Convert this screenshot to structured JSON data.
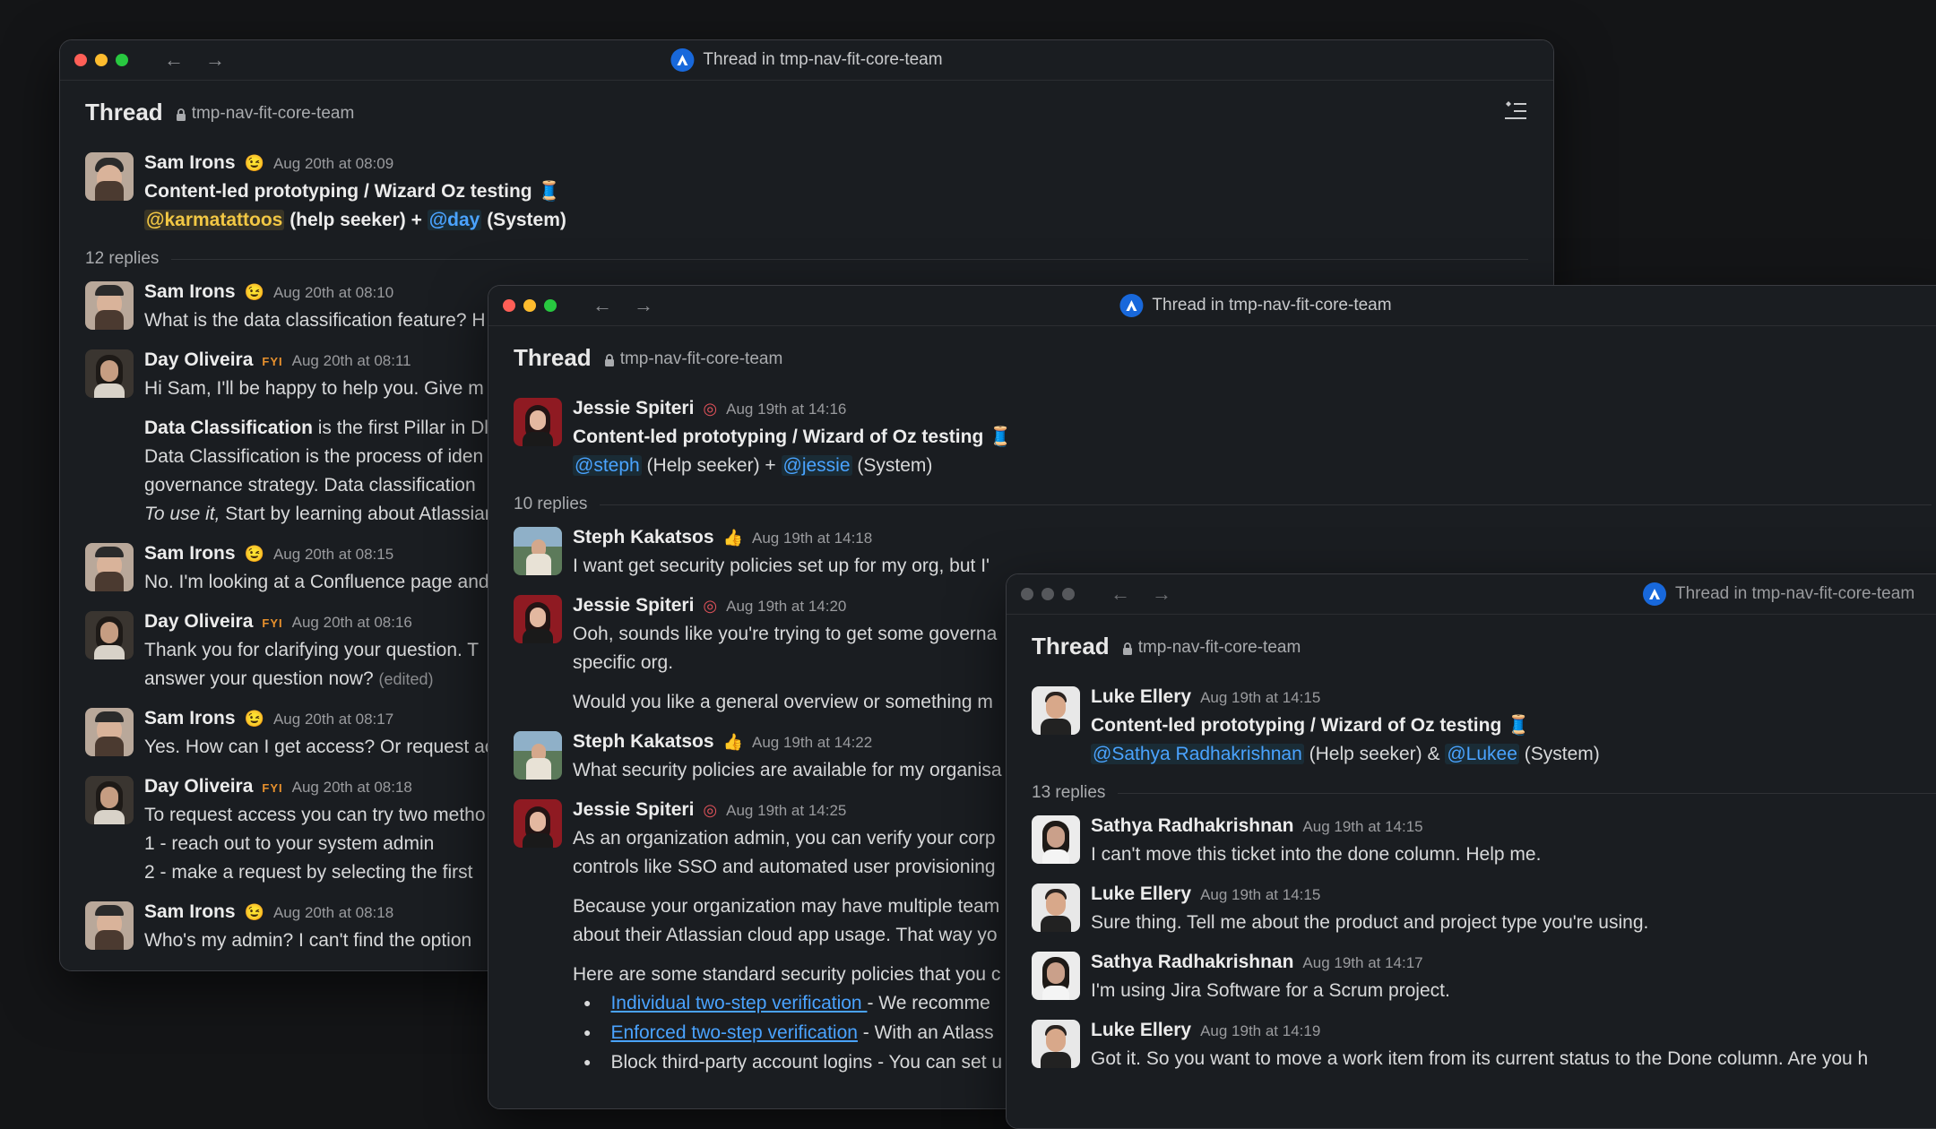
{
  "win1": {
    "title": "Thread in tmp-nav-fit-core-team",
    "thread_label": "Thread",
    "channel": "tmp-nav-fit-core-team",
    "root": {
      "name": "Sam Irons",
      "status": "😉",
      "time": "Aug 20th at 08:09",
      "line1": "Content-led prototyping / Wizard Oz testing",
      "emoji": "🧵",
      "mention1": "@karmatattoos",
      "mid": " (help seeker) + ",
      "mention2": "@day",
      "tail": " (System)"
    },
    "replies": "12 replies",
    "messages": [
      {
        "name": "Sam Irons",
        "status": "😉",
        "time": "Aug 20th at 08:10",
        "lines": [
          "What is the data classification feature? H"
        ]
      },
      {
        "name": "Day Oliveira",
        "status": "FYI",
        "time": "Aug 20th at 08:11",
        "lines": [
          "Hi Sam, I'll be happy to help you. Give m"
        ]
      },
      {
        "bold": "Data Classification",
        "rest": " is the first Pillar in Dl",
        "lines": [
          "Data Classification is the process of iden",
          "governance strategy. Data classification"
        ],
        "italic": "To use it,",
        "italic_rest": " Start by learning about Atlassian"
      },
      {
        "name": "Sam Irons",
        "status": "😉",
        "time": "Aug 20th at 08:15",
        "lines": [
          "No. I'm looking at a Confluence page and"
        ]
      },
      {
        "name": "Day Oliveira",
        "status": "FYI",
        "time": "Aug 20th at 08:16",
        "lines": [
          "Thank you for clarifying your question. T",
          "answer your question now?"
        ],
        "edited": "(edited)"
      },
      {
        "name": "Sam Irons",
        "status": "😉",
        "time": "Aug 20th at 08:17",
        "lines": [
          "Yes. How can I get access? Or request ac"
        ]
      },
      {
        "name": "Day Oliveira",
        "status": "FYI",
        "time": "Aug 20th at 08:18",
        "lines": [
          "To request access you can try two metho",
          "1 - reach out to your system admin",
          "2 - make a request by selecting the first"
        ]
      },
      {
        "name": "Sam Irons",
        "status": "😉",
        "time": "Aug 20th at 08:18",
        "lines": [
          "Who's my admin? I can't find the option"
        ]
      }
    ]
  },
  "win2": {
    "title": "Thread in tmp-nav-fit-core-team",
    "thread_label": "Thread",
    "channel": "tmp-nav-fit-core-team",
    "root": {
      "name": "Jessie Spiteri",
      "status": "◎",
      "time": "Aug 19th at 14:16",
      "line1": "Content-led prototyping / Wizard of Oz testing",
      "emoji": "🧵",
      "mention1": "@steph",
      "mid": " (Help seeker) + ",
      "mention2": "@jessie",
      "tail": " (System)"
    },
    "replies": "10 replies",
    "messages": [
      {
        "name": "Steph Kakatsos",
        "status": "👍",
        "time": "Aug 19th at 14:18",
        "lines": [
          "I want get security policies set up for my org, but I'"
        ]
      },
      {
        "name": "Jessie Spiteri",
        "status": "◎",
        "time": "Aug 19th at 14:20",
        "lines": [
          "Ooh, sounds like you're trying to get some governa",
          "specific org."
        ],
        "after": "Would you like a general overview or something m"
      },
      {
        "name": "Steph Kakatsos",
        "status": "👍",
        "time": "Aug 19th at 14:22",
        "lines": [
          "What security policies are available for my organisa"
        ]
      },
      {
        "name": "Jessie Spiteri",
        "status": "◎",
        "time": "Aug 19th at 14:25",
        "lines": [
          "As an organization admin, you can verify your corp",
          "controls like SSO and automated user provisioning"
        ],
        "para2": [
          "Because your organization may have multiple team",
          "about their Atlassian cloud app usage. That way yo"
        ],
        "para3": "Here are some standard security policies that you c",
        "bullets": [
          {
            "link": "Individual two-step verification ",
            "rest": "- We recomme"
          },
          {
            "link": "Enforced two-step verification",
            "rest": " - With an Atlass"
          },
          {
            "link": "",
            "rest": "Block third-party account logins - You can set u"
          }
        ]
      }
    ]
  },
  "win3": {
    "title": "Thread in tmp-nav-fit-core-team",
    "thread_label": "Thread",
    "channel": "tmp-nav-fit-core-team",
    "root": {
      "name": "Luke Ellery",
      "time": "Aug 19th at 14:15",
      "line1": "Content-led prototyping / Wizard of Oz testing",
      "emoji": "🧵",
      "mention1": "@Sathya Radhakrishnan",
      "mid": " (Help seeker) & ",
      "mention2": "@Lukee",
      "tail": " (System)"
    },
    "replies": "13 replies",
    "messages": [
      {
        "name": "Sathya Radhakrishnan",
        "time": "Aug 19th at 14:15",
        "lines": [
          "I can't move this ticket into the done column. Help me."
        ]
      },
      {
        "name": "Luke Ellery",
        "time": "Aug 19th at 14:15",
        "lines": [
          "Sure thing. Tell me about the product and project type you're using."
        ]
      },
      {
        "name": "Sathya Radhakrishnan",
        "time": "Aug 19th at 14:17",
        "lines": [
          "I'm using Jira Software for a Scrum project."
        ]
      },
      {
        "name": "Luke Ellery",
        "time": "Aug 19th at 14:19",
        "lines": [
          "Got it. So you want to move a work item from its current status to the Done column. Are you h"
        ]
      }
    ]
  }
}
